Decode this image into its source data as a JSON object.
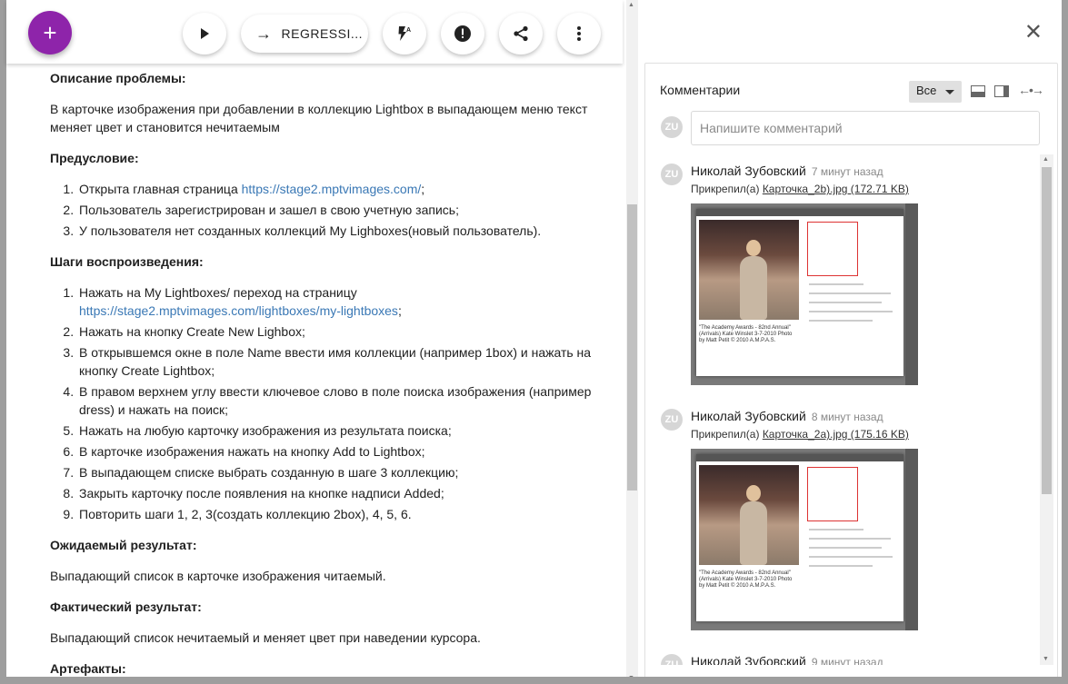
{
  "toolbar": {
    "add": "+",
    "pill_label": "REGRESSI...",
    "pill_arrow": "→"
  },
  "issue": {
    "problem_heading": "Описание проблемы:",
    "problem_text": "В карточке изображения при добавлении в коллекцию Lightbox в выпадающем меню текст меняет цвет и становится нечитаемым",
    "precondition_heading": "Предусловие:",
    "preconditions": [
      {
        "before": "Открыта главная страница ",
        "link": "https://stage2.mptvimages.com/",
        "after": ";"
      },
      {
        "before": "Пользователь зарегистрирован и зашел в свою учетную запись;",
        "link": "",
        "after": ""
      },
      {
        "before": "У пользователя нет созданных коллекций My Lighboxes(новый пользователь).",
        "link": "",
        "after": ""
      }
    ],
    "steps_heading": "Шаги воспроизведения:",
    "steps": [
      {
        "before": "Нажать на My Lightboxes/ переход на страницу ",
        "link": "https://stage2.mptvimages.com/lightboxes/my-lightboxes",
        "after": ";"
      },
      {
        "before": "Нажать на кнопку Create New Lighbox;",
        "link": "",
        "after": ""
      },
      {
        "before": "В открывшемся окне в поле Name ввести имя коллекции (например 1box) и нажать на кнопку Create Lightbox;",
        "link": "",
        "after": ""
      },
      {
        "before": "В правом верхнем углу ввести ключевое слово в поле поиска изображения (например dress) и нажать на поиск;",
        "link": "",
        "after": ""
      },
      {
        "before": "Нажать на любую карточку изображения из результата поиска;",
        "link": "",
        "after": ""
      },
      {
        "before": "В карточке изображения нажать на кнопку Add to Lightbox;",
        "link": "",
        "after": ""
      },
      {
        "before": "В выпадающем списке выбрать созданную в шаге 3 коллекцию;",
        "link": "",
        "after": ""
      },
      {
        "before": "Закрыть карточку после появления на кнопке надписи Added;",
        "link": "",
        "after": ""
      },
      {
        "before": "Повторить шаги 1, 2, 3(создать коллекцию 2box), 4, 5, 6.",
        "link": "",
        "after": ""
      }
    ],
    "expected_heading": "Ожидаемый результат:",
    "expected_text": "Выпадающий список в карточке изображения читаемый.",
    "actual_heading": "Фактический результат:",
    "actual_text": "Выпадающий список нечитаемый и меняет цвет при наведении курсора.",
    "artifacts_heading": "Артефакты:"
  },
  "comments": {
    "title": "Комментарии",
    "filter_value": "Все",
    "input_placeholder": "Напишите комментарий",
    "current_user_initials": "ZU",
    "items": [
      {
        "initials": "ZU",
        "author": "Николай Зубовский",
        "time": "7 минут назад",
        "attach_prefix": "Прикрепил(а) ",
        "attach_name": "Карточка_2b).jpg (172.71 KB)",
        "caption": "\"The Academy Awards - 82nd Annual\" (Arrivals) Kate Winslet 3-7-2010 Photo by Matt Petit © 2010 A.M.P.A.S."
      },
      {
        "initials": "ZU",
        "author": "Николай Зубовский",
        "time": "8 минут назад",
        "attach_prefix": "Прикрепил(а) ",
        "attach_name": "Карточка_2a).jpg (175.16 KB)",
        "caption": "\"The Academy Awards - 82nd Annual\" (Arrivals) Kate Winslet 3-7-2010 Photo by Matt Petit © 2010 A.M.P.A.S."
      },
      {
        "initials": "ZU",
        "author": "Николай Зубовский",
        "time": "9 минут назад"
      }
    ]
  },
  "colors": {
    "fab": "#8e24aa",
    "link": "#3a78b5"
  }
}
